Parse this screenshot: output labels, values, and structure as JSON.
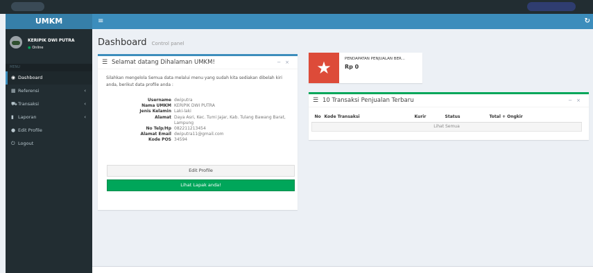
{
  "app": {
    "logo": "UMKM",
    "nav_toggle_icon": "hamburger-icon",
    "refresh_icon": "refresh-icon"
  },
  "user": {
    "name": "KERIPIK DWI PUTRA",
    "status": "Online"
  },
  "sidebar": {
    "header": "MENU",
    "items": [
      {
        "label": "Dashboard",
        "icon": "dashboard-icon",
        "glyph": "◉",
        "active": true,
        "has_children": false
      },
      {
        "label": "Referensi",
        "icon": "table-icon",
        "glyph": "▦",
        "active": false,
        "has_children": true
      },
      {
        "label": "Transaksi",
        "icon": "cart-icon",
        "glyph": "⛟",
        "active": false,
        "has_children": true
      },
      {
        "label": "Laporan",
        "icon": "book-icon",
        "glyph": "▮",
        "active": false,
        "has_children": true
      },
      {
        "label": "Edit Profile",
        "icon": "user-icon",
        "glyph": "●",
        "active": false,
        "has_children": false
      },
      {
        "label": "Logout",
        "icon": "power-icon",
        "glyph": "⏻",
        "active": false,
        "has_children": false
      }
    ]
  },
  "page": {
    "title": "Dashboard",
    "subtitle": "Control panel"
  },
  "welcome": {
    "title": "Selamat datang Dihalaman UMKM!",
    "intro": "Silahkan mengelola Semua data melalui menu yang sudah kita sediakan dibelah kiri anda, berikut data profile anda :",
    "profile": [
      {
        "key": "Username",
        "value": "dwiputra"
      },
      {
        "key": "Nama UMKM",
        "value": "KERIPIK DWI PUTRA"
      },
      {
        "key": "Jenis Kelamin",
        "value": "Laki-laki"
      },
      {
        "key": "Alamat",
        "value": "Daya Asri, Kec. Tumi Jajar, Kab. Tulang Bawang Barat, Lampung"
      },
      {
        "key": "No Telp/Hp",
        "value": "082211213454"
      },
      {
        "key": "Alamat Email",
        "value": "dwiputra11@gmail.com"
      },
      {
        "key": "Kode POS",
        "value": "34594"
      }
    ],
    "edit_button": "Edit Profile",
    "lapak_button": "Lihat Lapak anda!"
  },
  "info": {
    "label": "PENDAPATAN PENJUALAN BER...",
    "value": "Rp 0",
    "icon": "star-icon"
  },
  "transactions": {
    "title": "10 Transaksi Penjualan Terbaru",
    "columns": [
      "No",
      "Kode Transaksi",
      "Kurir",
      "Status",
      "Total + Ongkir"
    ],
    "see_all": "Lihat Semua"
  },
  "colors": {
    "primary": "#3c8dbc",
    "success": "#00a65a",
    "danger": "#dd4b39",
    "sidebar": "#222d32"
  }
}
